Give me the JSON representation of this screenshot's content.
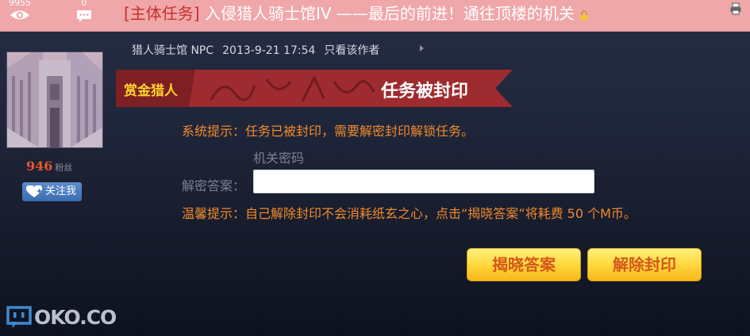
{
  "header": {
    "views": "9955",
    "replies": "0",
    "title_tag": "[主体任务]",
    "title_text": " 入侵猎人骑士馆IV ——最后的前进！通往顶楼的机关"
  },
  "author": {
    "fans_count": "946",
    "fans_label": "粉丝",
    "follow_label": "关注我"
  },
  "post_meta": {
    "author": "猎人骑士馆 NPC",
    "date": "2013-9-21 17:54",
    "only_author": "只看该作者"
  },
  "ribbon": {
    "left": "赏金猎人",
    "right": "任务被封印",
    "left_color": "#ffd42a",
    "band_color": "#9e2b2f"
  },
  "content": {
    "system_tip": "系统提示：任务已被封印，需要解密封印解锁任务。",
    "field_hint": "机关密码",
    "answer_label": "解密答案：",
    "answer_value": "",
    "warm_tip": "温馨提示：自己解除封印不会消耗纸玄之心，点击“揭晓答案”将耗费 50 个M币。"
  },
  "buttons": {
    "reveal": "揭晓答案",
    "unseal": "解除封印"
  },
  "watermark": "OKO.CO",
  "icons": {
    "views": "eye-icon",
    "replies": "comment-icon",
    "lock": "lock-icon",
    "print": "print-icon",
    "follow": "heart-icon"
  }
}
